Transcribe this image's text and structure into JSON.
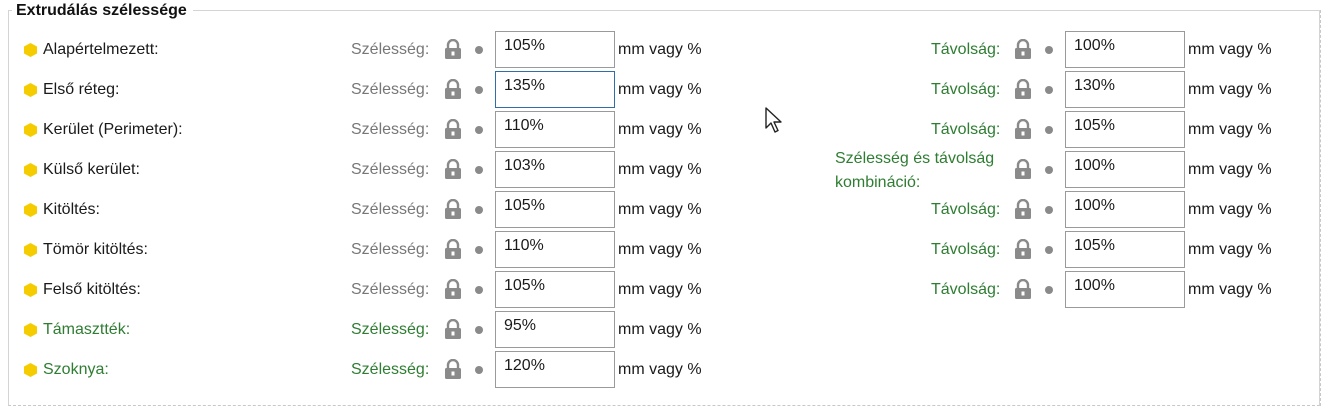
{
  "group": {
    "title": "Extrudálás szélessége"
  },
  "rows": [
    {
      "label": "Alapértelmezett:",
      "label_color": "normal",
      "width_label": "Szélesség:",
      "width_value": "105%",
      "width_unit": "mm vagy %",
      "spacing_label": "Távolság:",
      "spacing_value": "100%",
      "spacing_unit": "mm vagy %"
    },
    {
      "label": "Első réteg:",
      "label_color": "normal",
      "width_label": "Szélesség:",
      "width_value": "135%",
      "width_unit": "mm vagy %",
      "spacing_label": "Távolság:",
      "spacing_value": "130%",
      "spacing_unit": "mm vagy %"
    },
    {
      "label": "Kerület (Perimeter):",
      "label_color": "normal",
      "width_label": "Szélesség:",
      "width_value": "110%",
      "width_unit": "mm vagy %",
      "spacing_label": "Távolság:",
      "spacing_value": "105%",
      "spacing_unit": "mm vagy %"
    },
    {
      "label": "Külső kerület:",
      "label_color": "normal",
      "width_label": "Szélesség:",
      "width_value": "103%",
      "width_unit": "mm vagy %",
      "spacing_label_line1": "Szélesség és távolság",
      "spacing_label_line2": "kombináció:",
      "spacing_value": "100%",
      "spacing_unit": "mm vagy %"
    },
    {
      "label": "Kitöltés:",
      "label_color": "normal",
      "width_label": "Szélesség:",
      "width_value": "105%",
      "width_unit": "mm vagy %",
      "spacing_label": "Távolság:",
      "spacing_value": "100%",
      "spacing_unit": "mm vagy %"
    },
    {
      "label": "Tömör kitöltés:",
      "label_color": "normal",
      "width_label": "Szélesség:",
      "width_value": "110%",
      "width_unit": "mm vagy %",
      "spacing_label": "Távolság:",
      "spacing_value": "105%",
      "spacing_unit": "mm vagy %"
    },
    {
      "label": "Felső kitöltés:",
      "label_color": "normal",
      "width_label": "Szélesség:",
      "width_value": "105%",
      "width_unit": "mm vagy %",
      "spacing_label": "Távolság:",
      "spacing_value": "100%",
      "spacing_unit": "mm vagy %"
    },
    {
      "label": "Támasztték:",
      "label_color": "green",
      "width_label": "Szélesség:",
      "width_value": "95%",
      "width_unit": "mm vagy %"
    },
    {
      "label": "Szoknya:",
      "label_color": "green",
      "width_label": "Szélesség:",
      "width_value": "120%",
      "width_unit": "mm vagy %"
    }
  ],
  "colors": {
    "accent_green": "#2e7d32",
    "bullet_yellow": "#f5cc00",
    "grey_label": "#777777",
    "focus_border": "#2f6fa8"
  },
  "icons": {
    "bullet": "hexagon-bullet-icon",
    "lock": "lock-icon",
    "dot": "dot-icon",
    "cursor": "mouse-cursor-icon"
  }
}
